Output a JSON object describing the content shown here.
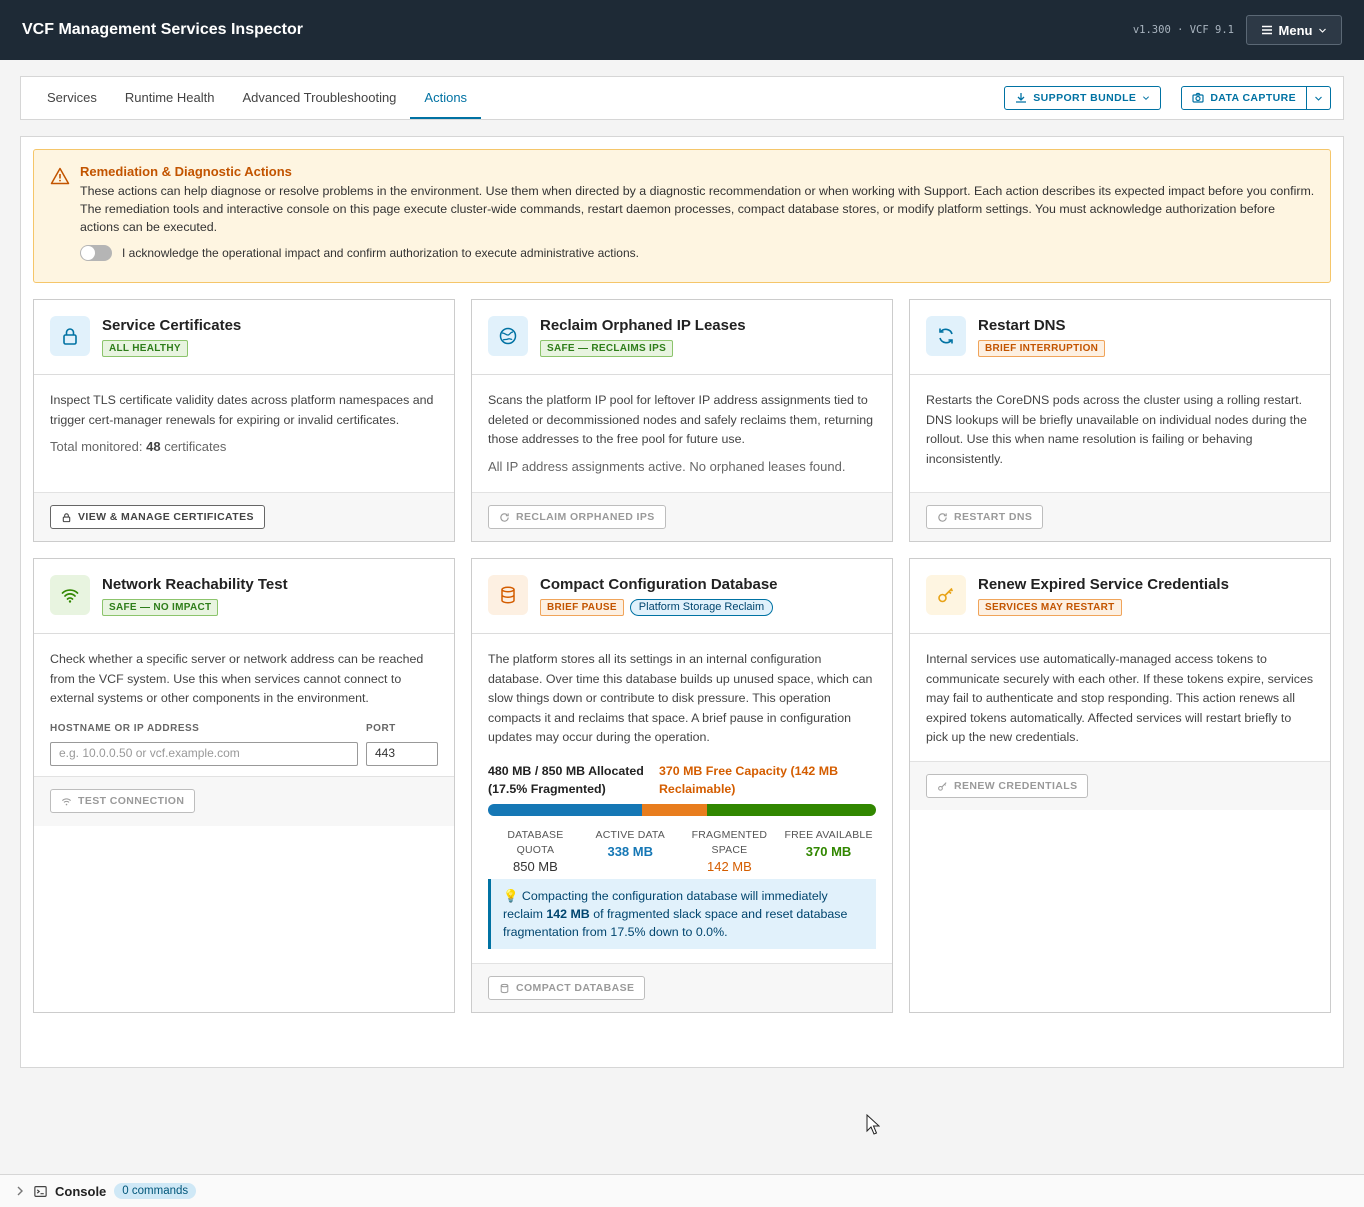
{
  "header": {
    "title": "VCF Management Services Inspector",
    "version": "v1.300 · VCF 9.1",
    "menu_label": "Menu"
  },
  "tabs": [
    {
      "label": "Services",
      "active": false
    },
    {
      "label": "Runtime Health",
      "active": false
    },
    {
      "label": "Advanced Troubleshooting",
      "active": false
    },
    {
      "label": "Actions",
      "active": true
    }
  ],
  "toolbar": {
    "support_bundle": "SUPPORT BUNDLE",
    "data_capture": "DATA CAPTURE"
  },
  "alert": {
    "title": "Remediation & Diagnostic Actions",
    "body": "These actions can help diagnose or resolve problems in the environment. Use them when directed by a diagnostic recommendation or when working with Support. Each action describes its expected impact before you confirm. The remediation tools and interactive console on this page execute cluster-wide commands, restart daemon processes, compact database stores, or modify platform settings. You must acknowledge authorization before actions can be executed.",
    "ack_label": "I acknowledge the operational impact and confirm authorization to execute administrative actions.",
    "ack_checked": false
  },
  "cards": {
    "certs": {
      "title": "Service Certificates",
      "badge": "ALL HEALTHY",
      "desc": "Inspect TLS certificate validity dates across platform namespaces and trigger cert-manager renewals for expiring or invalid certificates.",
      "note_prefix": "Total monitored: ",
      "note_count": "48",
      "note_suffix": " certificates",
      "button": "VIEW & MANAGE CERTIFICATES"
    },
    "ip": {
      "title": "Reclaim Orphaned IP Leases",
      "badge": "SAFE — RECLAIMS IPS",
      "desc": "Scans the platform IP pool for leftover IP address assignments tied to deleted or decommissioned nodes and safely reclaims them, returning those addresses to the free pool for future use.",
      "note": "All IP address assignments active. No orphaned leases found.",
      "button": "RECLAIM ORPHANED IPS"
    },
    "dns": {
      "title": "Restart DNS",
      "badge": "BRIEF INTERRUPTION",
      "desc": "Restarts the CoreDNS pods across the cluster using a rolling restart. DNS lookups will be briefly unavailable on individual nodes during the rollout. Use this when name resolution is failing or behaving inconsistently.",
      "button": "RESTART DNS"
    },
    "net": {
      "title": "Network Reachability Test",
      "badge": "SAFE — NO IMPACT",
      "desc": "Check whether a specific server or network address can be reached from the VCF system. Use this when services cannot connect to external systems or other components in the environment.",
      "host_label": "HOSTNAME OR IP ADDRESS",
      "host_placeholder": "e.g. 10.0.0.50 or vcf.example.com",
      "port_label": "PORT",
      "port_value": "443",
      "button": "TEST CONNECTION"
    },
    "db": {
      "title": "Compact Configuration Database",
      "badge1": "BRIEF PAUSE",
      "badge2": "Platform Storage Reclaim",
      "desc": "The platform stores all its settings in an internal configuration database. Over time this database builds up unused space, which can slow things down or contribute to disk pressure. This operation compacts it and reclaims that space. A brief pause in configuration updates may occur during the operation.",
      "alloc_left": "480 MB / 850 MB Allocated (17.5% Fragmented)",
      "alloc_right": "370 MB Free Capacity (142 MB Reclaimable)",
      "usage": {
        "quota_mb": 850,
        "active_mb": 338,
        "fragmented_mb": 142,
        "free_mb": 370
      },
      "stats": [
        {
          "label": "DATABASE QUOTA",
          "value": "850 MB",
          "color": "#333333"
        },
        {
          "label": "ACTIVE DATA",
          "value": "338 MB",
          "color": "#1577b5"
        },
        {
          "label": "FRAGMENTED SPACE",
          "value": "142 MB",
          "color": "#d45d00"
        },
        {
          "label": "FREE AVAILABLE",
          "value": "370 MB",
          "color": "#318700"
        }
      ],
      "info_prefix": "Compacting the configuration database will immediately reclaim ",
      "info_amount": "142 MB",
      "info_suffix": " of fragmented slack space and reset database fragmentation from 17.5% down to 0.0%.",
      "button": "COMPACT DATABASE"
    },
    "creds": {
      "title": "Renew Expired Service Credentials",
      "badge": "SERVICES MAY RESTART",
      "desc": "Internal services use automatically-managed access tokens to communicate securely with each other. If these tokens expire, services may fail to authenticate and stop responding. This action renews all expired tokens automatically. Affected services will restart briefly to pick up the new credentials.",
      "button": "RENEW CREDENTIALS"
    }
  },
  "console": {
    "label": "Console",
    "count": "0 commands"
  },
  "colors": {
    "accent": "#0072a3",
    "topbar": "#1e2a36",
    "warning": "#c25400",
    "success": "#318700"
  }
}
